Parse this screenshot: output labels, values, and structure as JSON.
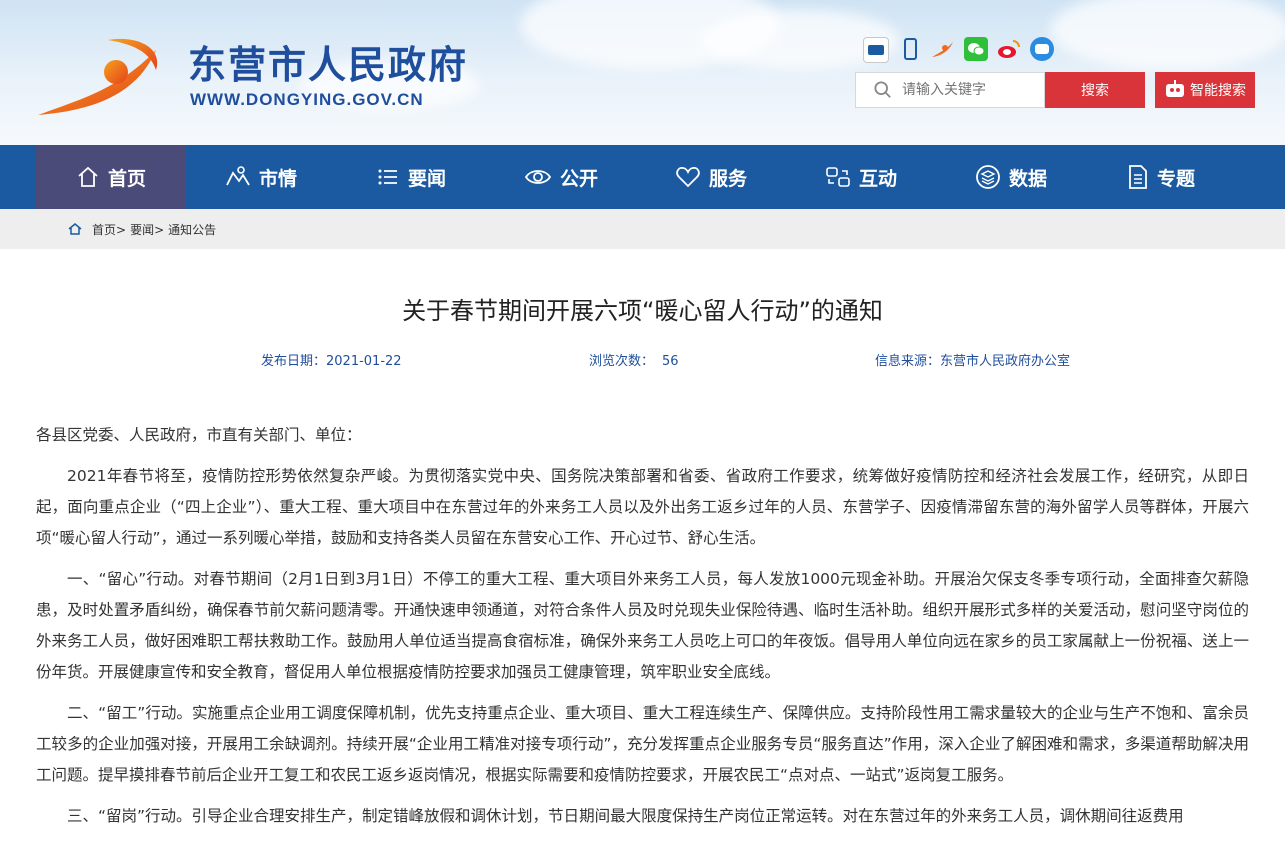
{
  "site": {
    "name": "东营市人民政府",
    "url": "WWW.DONGYING.GOV.CN"
  },
  "social_icons": [
    "gov-service-icon",
    "mobile-icon",
    "dongying-app-icon",
    "wechat-icon",
    "weibo-icon",
    "robot-icon"
  ],
  "search": {
    "placeholder": "请输入关键字",
    "button": "搜索",
    "smart_button": "智能搜索"
  },
  "nav": [
    {
      "label": "首页",
      "icon": "home-icon",
      "active": true
    },
    {
      "label": "市情",
      "icon": "city-icon"
    },
    {
      "label": "要闻",
      "icon": "list-icon"
    },
    {
      "label": "公开",
      "icon": "eye-icon"
    },
    {
      "label": "服务",
      "icon": "heart-icon"
    },
    {
      "label": "互动",
      "icon": "interact-icon"
    },
    {
      "label": "数据",
      "icon": "data-icon"
    },
    {
      "label": "专题",
      "icon": "document-icon"
    }
  ],
  "breadcrumb": [
    "首页>",
    "要闻>",
    "通知公告"
  ],
  "article": {
    "title": "关于春节期间开展六项“暖心留人行动”的通知",
    "date_label": "发布日期：",
    "date": "2021-01-22",
    "views_label": "浏览次数：",
    "views": "56",
    "source_label": "信息来源：",
    "source": "东营市人民政府办公室",
    "salutation": "各县区党委、人民政府，市直有关部门、单位：",
    "paragraphs": [
      "2021年春节将至，疫情防控形势依然复杂严峻。为贯彻落实党中央、国务院决策部署和省委、省政府工作要求，统筹做好疫情防控和经济社会发展工作，经研究，从即日起，面向重点企业（“四上企业”）、重大工程、重大项目中在东营过年的外来务工人员以及外出务工返乡过年的人员、东营学子、因疫情滞留东营的海外留学人员等群体，开展六项“暖心留人行动”，通过一系列暖心举措，鼓励和支持各类人员留在东营安心工作、开心过节、舒心生活。",
      "一、“留心”行动。对春节期间（2月1日到3月1日）不停工的重大工程、重大项目外来务工人员，每人发放1000元现金补助。开展治欠保支冬季专项行动，全面排查欠薪隐患，及时处置矛盾纠纷，确保春节前欠薪问题清零。开通快速申领通道，对符合条件人员及时兑现失业保险待遇、临时生活补助。组织开展形式多样的关爱活动，慰问坚守岗位的外来务工人员，做好困难职工帮扶救助工作。鼓励用人单位适当提高食宿标准，确保外来务工人员吃上可口的年夜饭。倡导用人单位向远在家乡的员工家属献上一份祝福、送上一份年货。开展健康宣传和安全教育，督促用人单位根据疫情防控要求加强员工健康管理，筑牢职业安全底线。",
      "二、“留工”行动。实施重点企业用工调度保障机制，优先支持重点企业、重大项目、重大工程连续生产、保障供应。支持阶段性用工需求量较大的企业与生产不饱和、富余员工较多的企业加强对接，开展用工余缺调剂。持续开展“企业用工精准对接专项行动”，充分发挥重点企业服务专员“服务直达”作用，深入企业了解困难和需求，多渠道帮助解决用工问题。提早摸排春节前后企业开工复工和农民工返乡返岗情况，根据实际需要和疫情防控要求，开展农民工“点对点、一站式”返岗复工服务。",
      "三、“留岗”行动。引导企业合理安排生产，制定错峰放假和调休计划，节日期间最大限度保持生产岗位正常运转。对在东营过年的外来务工人员，调休期间往返费用"
    ]
  }
}
